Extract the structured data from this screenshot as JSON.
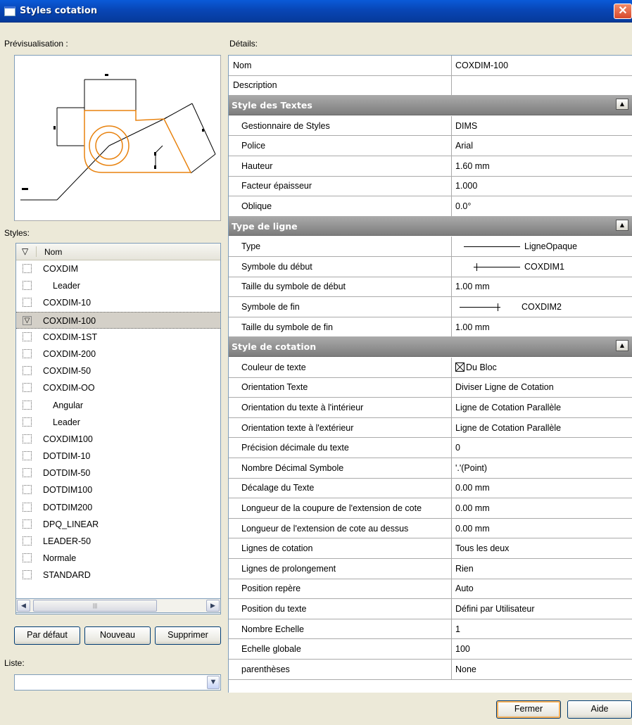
{
  "window": {
    "title": "Styles cotation",
    "close_glyph": "✕"
  },
  "labels": {
    "preview": "Prévisualisation :",
    "details": "Détails:",
    "styles": "Styles:",
    "liste": "Liste:"
  },
  "styles_list": {
    "header_icon": "filter-icon",
    "column": "Nom",
    "items": [
      {
        "name": "COXDIM",
        "indent": false,
        "selected": false
      },
      {
        "name": "Leader",
        "indent": true,
        "selected": false
      },
      {
        "name": "COXDIM-10",
        "indent": false,
        "selected": false
      },
      {
        "name": "COXDIM-100",
        "indent": false,
        "selected": true
      },
      {
        "name": "COXDIM-1ST",
        "indent": false,
        "selected": false
      },
      {
        "name": "COXDIM-200",
        "indent": false,
        "selected": false
      },
      {
        "name": "COXDIM-50",
        "indent": false,
        "selected": false
      },
      {
        "name": "COXDIM-OO",
        "indent": false,
        "selected": false
      },
      {
        "name": "Angular",
        "indent": true,
        "selected": false
      },
      {
        "name": "Leader",
        "indent": true,
        "selected": false
      },
      {
        "name": "COXDIM100",
        "indent": false,
        "selected": false
      },
      {
        "name": "DOTDIM-10",
        "indent": false,
        "selected": false
      },
      {
        "name": "DOTDIM-50",
        "indent": false,
        "selected": false
      },
      {
        "name": "DOTDIM100",
        "indent": false,
        "selected": false
      },
      {
        "name": "DOTDIM200",
        "indent": false,
        "selected": false
      },
      {
        "name": "DPQ_LINEAR",
        "indent": false,
        "selected": false
      },
      {
        "name": "LEADER-50",
        "indent": false,
        "selected": false
      },
      {
        "name": "Normale",
        "indent": false,
        "selected": false
      },
      {
        "name": "STANDARD",
        "indent": false,
        "selected": false
      }
    ]
  },
  "buttons": {
    "default": "Par défaut",
    "new": "Nouveau",
    "delete": "Supprimer",
    "close": "Fermer",
    "help": "Aide"
  },
  "liste_value": "",
  "details": {
    "nom": {
      "key": "Nom",
      "value": "COXDIM-100"
    },
    "description": {
      "key": "Description",
      "value": ""
    },
    "sections": [
      {
        "title": "Style des Textes",
        "rows": [
          {
            "key": "Gestionnaire de Styles",
            "value": "DIMS"
          },
          {
            "key": "Police",
            "value": "Arial"
          },
          {
            "key": "Hauteur",
            "value": "1.60 mm"
          },
          {
            "key": "Facteur épaisseur",
            "value": "1.000"
          },
          {
            "key": "Oblique",
            "value": "0.0°"
          }
        ]
      },
      {
        "title": "Type de ligne",
        "rows": [
          {
            "key": "Type",
            "value": "LigneOpaque",
            "symbol": "line"
          },
          {
            "key": "Symbole du début",
            "value": "COXDIM1",
            "symbol": "start-tick"
          },
          {
            "key": "Taille du symbole de début",
            "value": "1.00 mm"
          },
          {
            "key": "Symbole de fin",
            "value": "COXDIM2",
            "symbol": "end-tick"
          },
          {
            "key": "Taille du symbole de fin",
            "value": "1.00 mm"
          }
        ]
      },
      {
        "title": "Style de cotation",
        "rows": [
          {
            "key": "Couleur de texte",
            "value": "Du Bloc",
            "symbol": "color-box"
          },
          {
            "key": "Orientation Texte",
            "value": "Diviser Ligne de Cotation"
          },
          {
            "key": "Orientation du texte à l'intérieur",
            "value": "Ligne de Cotation Parallèle"
          },
          {
            "key": "Orientation texte à l'extérieur",
            "value": "Ligne de Cotation Parallèle"
          },
          {
            "key": "Précision décimale du texte",
            "value": "0"
          },
          {
            "key": "Nombre Décimal Symbole",
            "value": "'.'(Point)"
          },
          {
            "key": "Décalage du Texte",
            "value": "0.00 mm"
          },
          {
            "key": "Longueur de la coupure de l'extension de cote",
            "value": "0.00 mm"
          },
          {
            "key": "Longueur de l'extension de cote au dessus",
            "value": "0.00 mm"
          },
          {
            "key": "Lignes de cotation",
            "value": "Tous les deux"
          },
          {
            "key": "Lignes de prolongement",
            "value": "Rien"
          },
          {
            "key": "Position repère",
            "value": "Auto"
          },
          {
            "key": "Position du texte",
            "value": "Défini par Utilisateur"
          },
          {
            "key": "Nombre Echelle",
            "value": "1"
          },
          {
            "key": "Echelle globale",
            "value": "100"
          },
          {
            "key": "parenthèses",
            "value": "None"
          }
        ]
      }
    ]
  },
  "colors": {
    "title_bar": "#0846b6",
    "section_header": "#8a8a8a",
    "preview_shape": "#e8820e",
    "window_bg": "#ece9d8"
  }
}
